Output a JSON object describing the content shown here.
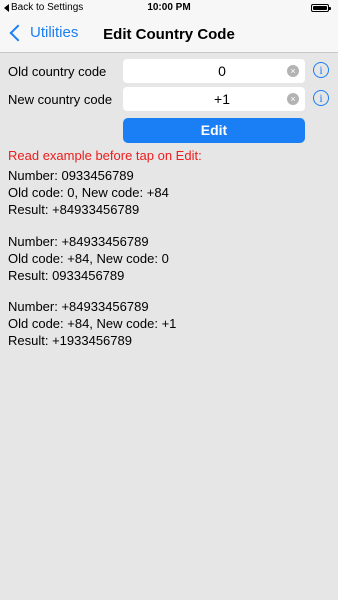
{
  "status_bar": {
    "back_label": "Back to Settings",
    "time": "10:00 PM"
  },
  "nav": {
    "back_label": "Utilities",
    "title": "Edit Country Code"
  },
  "form": {
    "old_label": "Old country code",
    "old_value": "0",
    "new_label": "New country code",
    "new_value": "+1",
    "clear_glyph": "×",
    "info_glyph": "i",
    "edit_label": "Edit"
  },
  "warning": "Read example before tap on Edit:",
  "examples": [
    {
      "number": "Number: 0933456789",
      "codes": "Old code: 0, New code: +84",
      "result": "Result: +84933456789"
    },
    {
      "number": "Number: +84933456789",
      "codes": "Old code: +84, New code: 0",
      "result": "Result: 0933456789"
    },
    {
      "number": "Number: +84933456789",
      "codes": "Old code: +84, New code: +1",
      "result": "Result: +1933456789"
    }
  ],
  "colors": {
    "accent": "#1a7ef5",
    "warning": "#ee1c1c",
    "background": "#e6e6e6"
  }
}
